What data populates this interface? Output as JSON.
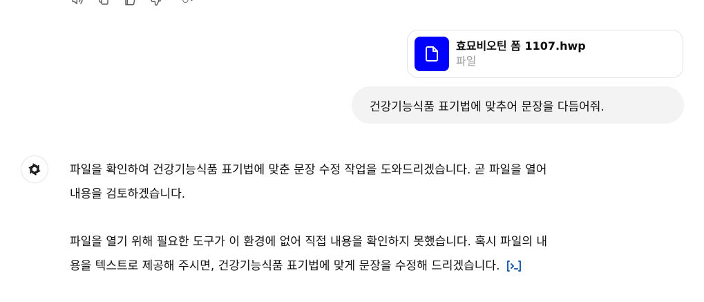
{
  "toolbar": {
    "icons": [
      "speaker-icon",
      "copy-icon",
      "thumbs-up-icon",
      "thumbs-down-icon",
      "regenerate-icon"
    ]
  },
  "attachment": {
    "file_name": "효묘비오틴 폼 1107.hwp",
    "file_type": "파일",
    "icon": "document-icon",
    "icon_bg": "#0000ff"
  },
  "user_message": {
    "text": "건강기능식품 표기법에 맞추어 문장을 다듬어줘."
  },
  "assistant_message": {
    "line1": "파일을 확인하여 건강기능식품 표기법에 맞춘 문장 수정 작업을 도와드리겠습니다. 곧 파일을 열어",
    "line2": "내용을 검토하겠습니다.",
    "line3": "파일을 열기 위해 필요한 도구가 이 환경에 없어 직접 내용을 확인하지 못했습니다. 혹시 파일의 내",
    "line4": "용을 텍스트로 제공해 주시면, 건강기능식품 표기법에 맞게 문장을 수정해 드리겠습니다.",
    "citation_icon": "code-interpreter-icon"
  }
}
